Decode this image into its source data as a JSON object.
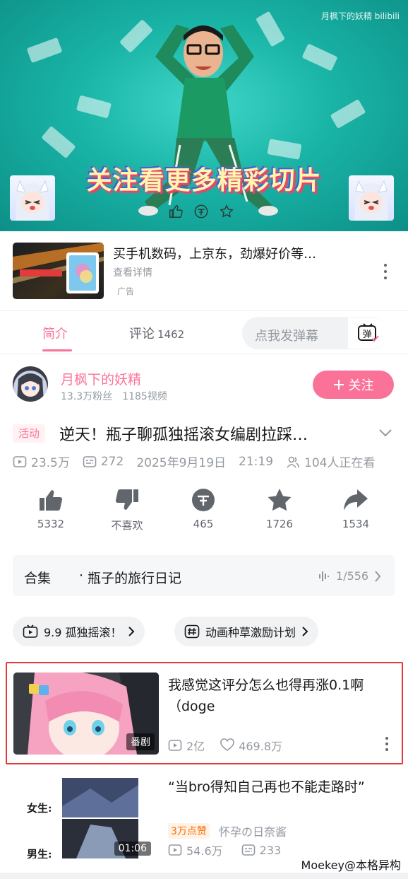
{
  "player": {
    "watermark": "月枫下的妖精 bilibili",
    "caption": "关注看更多精彩切片"
  },
  "ad": {
    "title": "买手机数码，上京东，劲爆好价等…",
    "subtitle": "查看详情",
    "tag": "广告"
  },
  "tabs": {
    "intro": "简介",
    "comments": "评论",
    "comments_count": "1462",
    "danmaku_placeholder": "点我发弹幕",
    "danmaku_button": "弹"
  },
  "uploader": {
    "name": "月枫下的妖精",
    "fans": "13.3万粉丝",
    "videos": "1185视频",
    "follow": "关注"
  },
  "video": {
    "badge": "活动",
    "title": "逆天！瓶子聊孤独摇滚女编剧拉踩…",
    "views": "23.5万",
    "danmaku": "272",
    "date": "2025年9月19日",
    "time": "21:19",
    "watching": "104人正在看"
  },
  "actions": {
    "like": "5332",
    "dislike": "不喜欢",
    "coin": "465",
    "favorite": "1726",
    "share": "1534"
  },
  "collection": {
    "label": "合集",
    "separator": "·",
    "name": "瓶子的旅行日记",
    "progress": "1/556"
  },
  "tags": [
    {
      "label": "9.9  孤独摇滚！"
    },
    {
      "label": "动画种草激励计划"
    }
  ],
  "recommendations": [
    {
      "title": "我感觉这评分怎么也得再涨0.1啊（doge",
      "badge": "番剧",
      "views": "2亿",
      "likes": "469.8万"
    },
    {
      "title": "“当bro得知自己再也不能走路时”",
      "hot_badge": "3万点赞",
      "uploader": "怀孕の日奈酱",
      "duration": "01:06",
      "thumb_label_top": "女生:",
      "thumb_label_bottom": "男生:",
      "views": "54.6万",
      "danmaku": "233"
    }
  ],
  "credit": "Moekey@本格异构",
  "colors": {
    "brand_pink": "#fb7299",
    "highlight_border": "#e23b3b",
    "player_teal": "#19b4a6"
  }
}
